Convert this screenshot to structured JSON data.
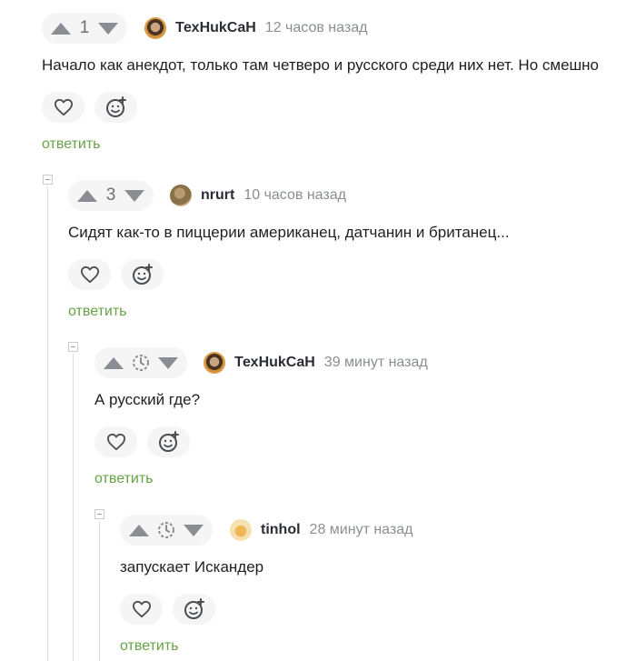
{
  "comments": [
    {
      "votes": "1",
      "author": "ТехНukCaH",
      "time": "12 часов назад",
      "text": "Начало как анекдот, только там четверо и русского среди них нет. Но смешно",
      "reply": "ответить"
    },
    {
      "votes": "3",
      "author": "nrurt",
      "time": "10 часов назад",
      "text": "Сидят как-то в пиццерии американец, датчанин и британец...",
      "reply": "ответить"
    },
    {
      "votes": "",
      "author": "ТехНukCaH",
      "time": "39 минут назад",
      "text": "А русский где?",
      "reply": "ответить"
    },
    {
      "votes": "",
      "author": "tinhol",
      "time": "28 минут назад",
      "text": "запускает Искандер",
      "reply": "ответить"
    }
  ],
  "icons": {
    "upvote": "arrow-up-icon",
    "downvote": "arrow-down-icon",
    "pending": "clock-icon",
    "like": "heart-icon",
    "react": "emoji-add-icon",
    "collapse": "collapse-icon"
  },
  "colors": {
    "reply_link": "#64a346",
    "pill_bg": "#f5f5f6",
    "muted": "#8a8d93"
  }
}
